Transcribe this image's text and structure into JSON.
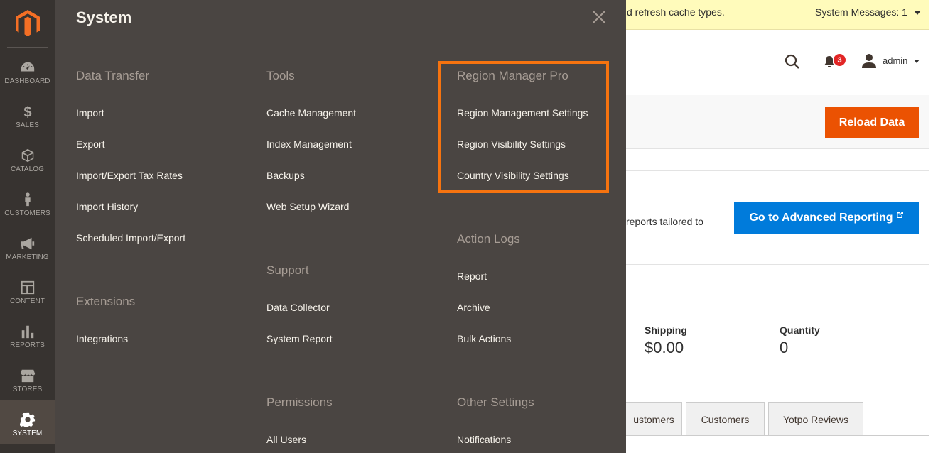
{
  "colors": {
    "nav_bg": "#373330",
    "menu_bg": "#4a4542",
    "accent_orange": "#eb5202",
    "highlight_orange": "#f6730f",
    "action_blue": "#007bdb",
    "notification_red": "#e22626"
  },
  "nav": {
    "logo_icon": "magento-logo-icon",
    "items": [
      {
        "label": "DASHBOARD",
        "icon": "speedometer-icon"
      },
      {
        "label": "SALES",
        "icon": "dollar-icon"
      },
      {
        "label": "CATALOG",
        "icon": "box-icon"
      },
      {
        "label": "CUSTOMERS",
        "icon": "person-icon"
      },
      {
        "label": "MARKETING",
        "icon": "megaphone-icon"
      },
      {
        "label": "CONTENT",
        "icon": "layout-icon"
      },
      {
        "label": "REPORTS",
        "icon": "bar-chart-icon"
      },
      {
        "label": "STORES",
        "icon": "storefront-icon"
      },
      {
        "label": "SYSTEM",
        "icon": "gear-icon"
      }
    ]
  },
  "background": {
    "system_message": "d refresh cache types.",
    "system_messages_count": "System Messages: 1",
    "notification_count": "3",
    "user_name": "admin",
    "reload_button": "Reload Data",
    "reports_text": "reports tailored to",
    "advanced_reporting_button": "Go to Advanced Reporting",
    "advanced_reporting_ext_icon": "external-link-icon",
    "stats": [
      {
        "label": "Shipping",
        "value": "$0.00"
      },
      {
        "label": "Quantity",
        "value": "0"
      }
    ],
    "tabs": [
      "ustomers",
      "Customers",
      "Yotpo Reviews"
    ]
  },
  "menu": {
    "title": "System",
    "close_icon": "close-icon",
    "columns": {
      "data_transfer": {
        "heading": "Data Transfer",
        "links": [
          "Import",
          "Export",
          "Import/Export Tax Rates",
          "Import History",
          "Scheduled Import/Export"
        ]
      },
      "extensions": {
        "heading": "Extensions",
        "links": [
          "Integrations"
        ]
      },
      "tools": {
        "heading": "Tools",
        "links": [
          "Cache Management",
          "Index Management",
          "Backups",
          "Web Setup Wizard"
        ]
      },
      "support": {
        "heading": "Support",
        "links": [
          "Data Collector",
          "System Report"
        ]
      },
      "permissions": {
        "heading": "Permissions",
        "links": [
          "All Users"
        ]
      },
      "region_manager": {
        "heading": "Region Manager Pro",
        "links": [
          "Region Management Settings",
          "Region Visibility Settings",
          "Country Visibility Settings"
        ]
      },
      "action_logs": {
        "heading": "Action Logs",
        "links": [
          "Report",
          "Archive",
          "Bulk Actions"
        ]
      },
      "other_settings": {
        "heading": "Other Settings",
        "links": [
          "Notifications"
        ]
      }
    }
  }
}
